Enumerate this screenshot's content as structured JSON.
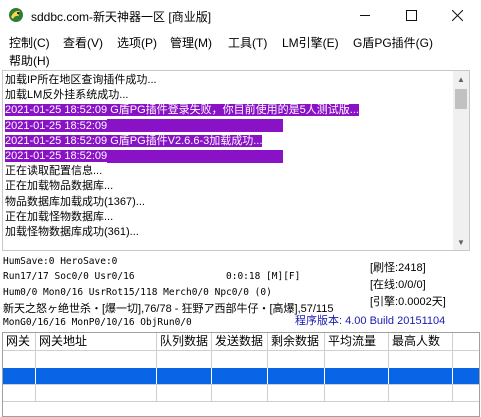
{
  "window": {
    "title": "sddbc.com-新天神器一区 [商业版]",
    "icon": "dragon-app-icon",
    "controls": {
      "minimize": "minimize-icon",
      "maximize": "maximize-icon",
      "close": "close-icon"
    }
  },
  "menu": {
    "items": [
      {
        "label": "控制(C)"
      },
      {
        "label": "查看(V)"
      },
      {
        "label": "选项(P)"
      },
      {
        "label": "管理(M)"
      },
      {
        "label": "工具(T)"
      },
      {
        "label": "LM引擎(E)"
      },
      {
        "label": "G盾PG插件(G)"
      },
      {
        "label": "帮助(H)"
      }
    ]
  },
  "log": {
    "highlight_color": "#8a12c6",
    "lines": [
      {
        "text": "加载IP所在地区查询插件成功...",
        "highlight": false
      },
      {
        "text": "加载LM反外挂系统成功...",
        "highlight": false
      },
      {
        "text": "2021-01-25 18:52:09 G盾PG插件登录失败，你目前使用的是5人测试版...",
        "highlight": true
      },
      {
        "text": "2021-01-25 18:52:09",
        "highlight": true,
        "trail": true
      },
      {
        "text": "2021-01-25 18:52:09 G盾PG插件V2.6.6-3加载成功...",
        "highlight": true
      },
      {
        "text": "2021-01-25 18:52:09",
        "highlight": true,
        "trail": true
      },
      {
        "text": "正在读取配置信息...",
        "highlight": false
      },
      {
        "text": "正在加载物品数据库...",
        "highlight": false
      },
      {
        "text": "物品数据库加载成功(1367)...",
        "highlight": false
      },
      {
        "text": "正在加载怪物数据库...",
        "highlight": false
      },
      {
        "text": "加载怪物数据库成功(361)...",
        "highlight": false
      }
    ]
  },
  "status": {
    "hum_save": "HumSave:0 HeroSave:0",
    "run": "Run17/17 Soc0/0 Usr0/16",
    "timer": "0:0:18 [M][F]",
    "hum": "Hum0/0 Mon0/16 UsrRot15/118 Merch0/0 Npc0/0 (0)",
    "event_line": "新天之怒ヶ绝世杀・[爆一切],76/78 - 狂野ア西部牛仔・[高爆],57/115",
    "mon": "MonG0/16/16 MonP0/10/16 ObjRun0/0",
    "refresh": "[刷怪:2418]",
    "online": "[在线:0/0/0]",
    "ratio": "[引擎:0.0002天]",
    "version": "程序版本: 4.00 Build 20151104"
  },
  "gate_table": {
    "columns": [
      "网关",
      "网关地址",
      "队列数据",
      "发送数据",
      "剩余数据",
      "平均流量",
      "最高人数"
    ],
    "selected_row": 1
  }
}
